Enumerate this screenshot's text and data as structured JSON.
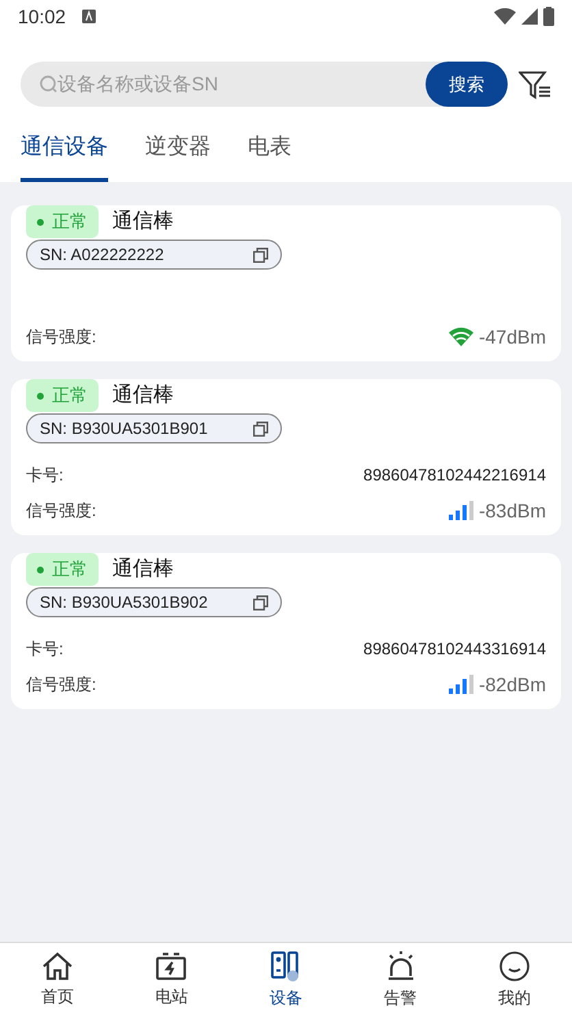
{
  "status_bar": {
    "time": "10:02"
  },
  "search": {
    "placeholder": "设备名称或设备SN",
    "button": "搜索"
  },
  "tabs": [
    {
      "label": "通信设备",
      "selected": true
    },
    {
      "label": "逆变器",
      "selected": false
    },
    {
      "label": "电表",
      "selected": false
    }
  ],
  "devices": [
    {
      "kind": "wifi",
      "status": "正常",
      "color": "#22a33a",
      "name": "通信棒",
      "sn": "SN: A022222222",
      "signal_label": "信号强度:",
      "signal": "-47dBm"
    },
    {
      "kind": "cellular",
      "status": "正常",
      "color": "#22a33a",
      "name": "通信棒",
      "sn": "SN: B930UA5301B901",
      "card_label": "卡号:",
      "card_no": "89860478102442216914",
      "signal_label": "信号强度:",
      "signal": "-83dBm"
    },
    {
      "kind": "cellular",
      "status": "正常",
      "color": "#22a33a",
      "name": "通信棒",
      "sn": "SN: B930UA5301B902",
      "card_label": "卡号:",
      "card_no": "89860478102443316914",
      "signal_label": "信号强度:",
      "signal": "-82dBm"
    }
  ],
  "bottom_nav": [
    {
      "label": "首页",
      "selected": false
    },
    {
      "label": "电站",
      "selected": false
    },
    {
      "label": "设备",
      "selected": true
    },
    {
      "label": "告警",
      "selected": false
    },
    {
      "label": "我的",
      "selected": false
    }
  ]
}
